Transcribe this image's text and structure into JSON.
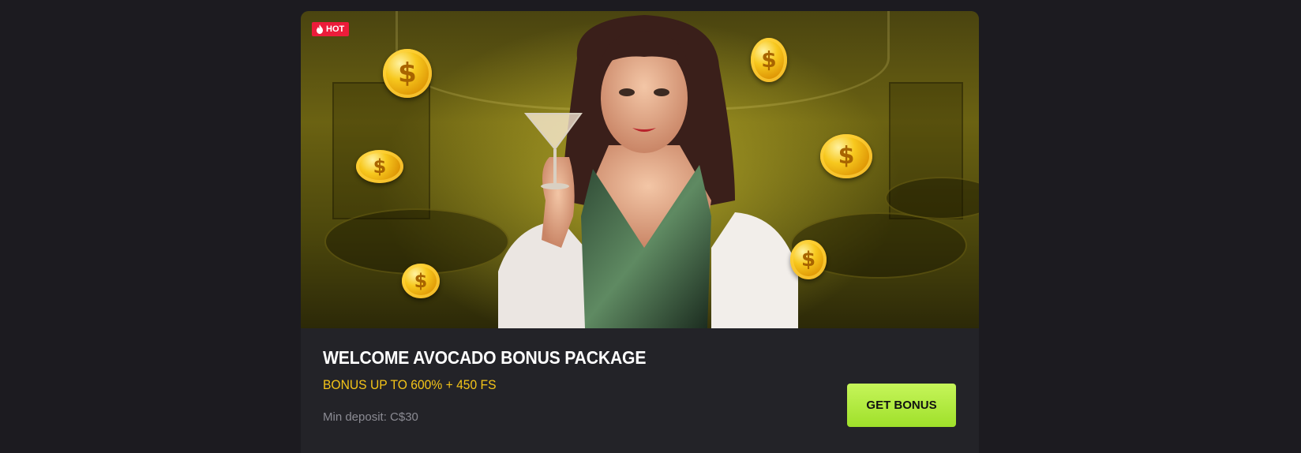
{
  "promo": {
    "badge": "HOT",
    "title": "WELCOME AVOCADO BONUS PACKAGE",
    "subtitle": "BONUS UP TO 600% + 450 FS",
    "min_deposit": "Min deposit: C$30",
    "cta_label": "GET BONUS"
  },
  "colors": {
    "page_bg": "#1c1b20",
    "card_bg": "#232328",
    "badge_red": "#ec1c3a",
    "accent_yellow": "#f5c518",
    "cta_green": "#b4ec3c"
  },
  "icons": {
    "badge": "flame-icon",
    "coin": "dollar-coin-icon"
  }
}
